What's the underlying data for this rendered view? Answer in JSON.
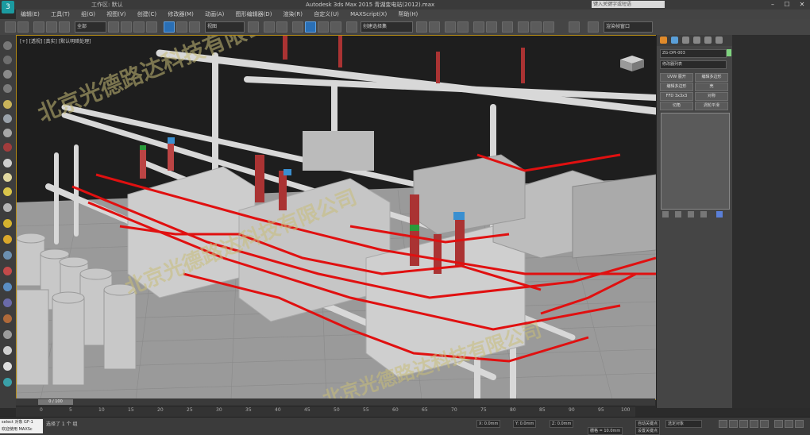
{
  "app": {
    "title": "Autodesk 3ds Max 2015    青湖变电站(2012).max",
    "workspace_label": "工作区: 默认",
    "search_placeholder": "键入关键字或短语",
    "logo_text": "3"
  },
  "menubar": {
    "items": [
      "编辑(E)",
      "工具(T)",
      "组(G)",
      "视图(V)",
      "创建(C)",
      "修改器(M)",
      "动画(A)",
      "图形编辑器(D)",
      "渲染(R)",
      "自定义(U)",
      "MAXScript(X)",
      "帮助(H)"
    ]
  },
  "toolbar": {
    "selection_filter": "全部",
    "view_dropdown": "视图",
    "named_set": "创建选择集",
    "render_setup_label": "渲染帧窗口"
  },
  "viewport": {
    "label": "[+] [透视] [真实] [默认明暗处理]"
  },
  "watermarks": [
    "北京光德路达科技有限公司",
    "北京光德路达科技有限公司",
    "北京光德路达科技有限公司"
  ],
  "command_panel": {
    "object_name": "ZG-DPI-003",
    "modifier_list": "修改器列表",
    "buttons": [
      "UVW 展开",
      "编辑多边形",
      "编辑多边形",
      "壳",
      "FFD 3x3x3",
      "对称",
      "切角",
      "涡轮平滑"
    ]
  },
  "timeline": {
    "frame_label": "0 / 100",
    "ticks": [
      "0",
      "5",
      "10",
      "15",
      "20",
      "25",
      "30",
      "35",
      "40",
      "45",
      "50",
      "55",
      "60",
      "65",
      "70",
      "75",
      "80",
      "85",
      "90",
      "95",
      "100"
    ]
  },
  "statusbar": {
    "listener_line1": "select 对象 GF-1",
    "listener_line2": "欢迎使用 MAXSc",
    "status_message": "选择了 1 个 组",
    "x_value": "X: 0.0mm",
    "y_value": "Y: 0.0mm",
    "z_value": "Z: 0.0mm",
    "grid_value": "栅格 = 10.0mm",
    "auto_key": "自动关键点",
    "set_key": "设置关键点",
    "selected_dropdown": "选定对象"
  },
  "colors": {
    "viewport_border": "#b38a16",
    "pipe_red": "#e01010",
    "equipment_gray": "#c9c9c9"
  }
}
